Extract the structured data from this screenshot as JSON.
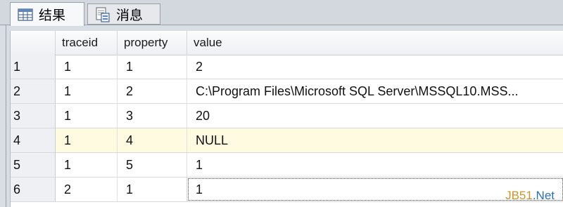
{
  "tabs": [
    {
      "label": "结果",
      "icon": "grid-icon",
      "active": true
    },
    {
      "label": "消息",
      "icon": "messages-icon",
      "active": false
    }
  ],
  "grid": {
    "columns": [
      "",
      "traceid",
      "property",
      "value"
    ],
    "rows": [
      {
        "num": "1",
        "traceid": "1",
        "property": "1",
        "value": "2"
      },
      {
        "num": "2",
        "traceid": "1",
        "property": "2",
        "value": "C:\\Program Files\\Microsoft SQL Server\\MSSQL10.MSS..."
      },
      {
        "num": "3",
        "traceid": "1",
        "property": "3",
        "value": "20"
      },
      {
        "num": "4",
        "traceid": "1",
        "property": "4",
        "value": "NULL"
      },
      {
        "num": "5",
        "traceid": "1",
        "property": "5",
        "value": "1"
      },
      {
        "num": "6",
        "traceid": "2",
        "property": "1",
        "value": "1"
      }
    ]
  },
  "watermark": {
    "part1": "JB51",
    "part2": ".Net"
  },
  "colors": {
    "null_highlight": "#fffbe0",
    "header_bg": "#eef0f3"
  }
}
